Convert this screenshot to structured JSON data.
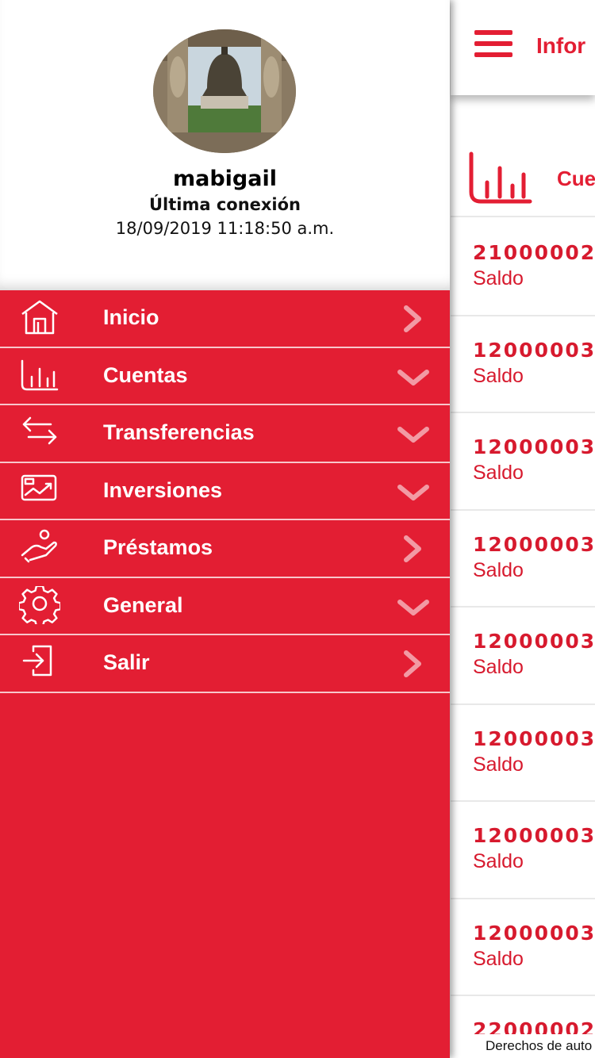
{
  "topbar": {
    "title": "Infor",
    "menu_icon": "hamburger-icon"
  },
  "section": {
    "title": "Cue",
    "icon": "bar-chart-icon"
  },
  "accounts": [
    {
      "number": "21000002",
      "label": "Saldo"
    },
    {
      "number": "12000003",
      "label": "Saldo"
    },
    {
      "number": "12000003",
      "label": "Saldo"
    },
    {
      "number": "12000003",
      "label": "Saldo"
    },
    {
      "number": "12000003",
      "label": "Saldo"
    },
    {
      "number": "12000003",
      "label": "Saldo"
    },
    {
      "number": "12000003",
      "label": "Saldo"
    },
    {
      "number": "12000003",
      "label": "Saldo"
    },
    {
      "number": "22000002",
      "label": ""
    }
  ],
  "footer": {
    "text": "Derechos de auto"
  },
  "profile": {
    "username": "mabigail",
    "last_login_label": "Última conexión",
    "last_login_value": "18/09/2019 11:18:50 a.m."
  },
  "menu": [
    {
      "label": "Inicio",
      "icon": "home-icon",
      "chevron": "right"
    },
    {
      "label": "Cuentas",
      "icon": "bar-chart-icon",
      "chevron": "down"
    },
    {
      "label": "Transferencias",
      "icon": "transfer-arrows-icon",
      "chevron": "down"
    },
    {
      "label": "Inversiones",
      "icon": "investment-icon",
      "chevron": "down"
    },
    {
      "label": "Préstamos",
      "icon": "loan-hand-icon",
      "chevron": "right"
    },
    {
      "label": "General",
      "icon": "gear-icon",
      "chevron": "down"
    },
    {
      "label": "Salir",
      "icon": "logout-icon",
      "chevron": "right"
    }
  ],
  "colors": {
    "brand_red": "#e31e33",
    "text_red": "#d71a2e",
    "white": "#ffffff"
  }
}
